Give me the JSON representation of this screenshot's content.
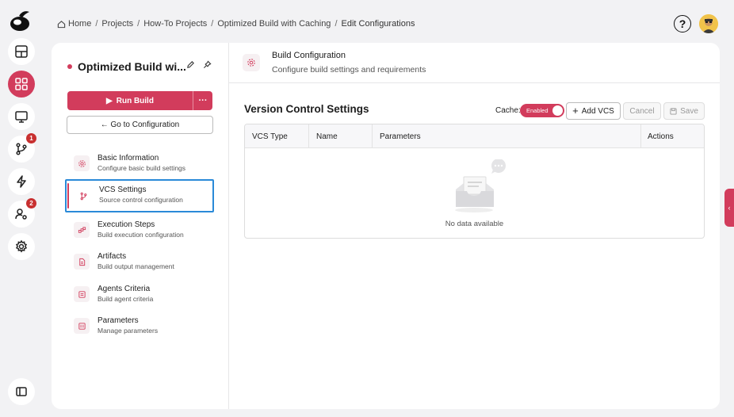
{
  "breadcrumb": [
    "Home",
    "Projects",
    "How-To Projects",
    "Optimized Build with Caching",
    "Edit Configurations"
  ],
  "rail": {
    "badges": {
      "vcs": "1",
      "users": "2"
    }
  },
  "project": {
    "title": "Optimized Build wi...",
    "run_label": "Run Build",
    "more_label": "···",
    "goto_label": "← Go to Configuration"
  },
  "menu": [
    {
      "title": "Basic Information",
      "subtitle": "Configure basic build settings"
    },
    {
      "title": "VCS Settings",
      "subtitle": "Source control configuration"
    },
    {
      "title": "Execution Steps",
      "subtitle": "Build execution configuration"
    },
    {
      "title": "Artifacts",
      "subtitle": "Build output management"
    },
    {
      "title": "Agents Criteria",
      "subtitle": "Build agent criteria"
    },
    {
      "title": "Parameters",
      "subtitle": "Manage parameters"
    }
  ],
  "section": {
    "title": "Build Configuration",
    "subtitle": "Configure build settings and requirements"
  },
  "vcs": {
    "title": "Version Control Settings",
    "cache_label": "Cache:",
    "cache_state": "Enabled",
    "add_label": "Add VCS",
    "cancel_label": "Cancel",
    "save_label": "Save",
    "columns": [
      "VCS Type",
      "Name",
      "Parameters",
      "Actions"
    ],
    "empty_text": "No data available"
  },
  "colors": {
    "accent": "#d23c5c",
    "focus": "#2a8ad8"
  },
  "help_label": "?"
}
